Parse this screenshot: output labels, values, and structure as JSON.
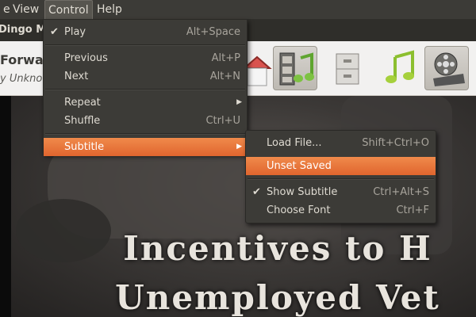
{
  "menubar": {
    "items": [
      "e",
      "View",
      "Control",
      "Help"
    ]
  },
  "window_title": "Dingo Me",
  "now_playing": {
    "title": "Forwar",
    "artist": "y Unkno"
  },
  "toolbar": {
    "buttons": [
      {
        "icon": "home-icon"
      },
      {
        "icon": "music-video-icon"
      },
      {
        "icon": "cabinet-icon"
      },
      {
        "icon": "music-note-icon"
      },
      {
        "icon": "film-reel-icon"
      }
    ]
  },
  "video_caption": {
    "line1": "Incentives to H",
    "line2": "Unemployed Vet"
  },
  "control_menu": {
    "items": [
      {
        "label": "Play",
        "accel": "Alt+Space",
        "checked": true
      },
      {
        "label": "Previous",
        "accel": "Alt+P"
      },
      {
        "label": "Next",
        "accel": "Alt+N"
      },
      {
        "label": "Repeat",
        "accel": ""
      },
      {
        "label": "Shuffle",
        "accel": "Ctrl+U"
      },
      {
        "label": "Subtitle",
        "accel": ""
      }
    ]
  },
  "subtitle_menu": {
    "items": [
      {
        "label": "Load File...",
        "accel": "Shift+Ctrl+O"
      },
      {
        "label": "Unset Saved",
        "accel": ""
      },
      {
        "label": "Show Subtitle",
        "accel": "Ctrl+Alt+S",
        "checked": true
      },
      {
        "label": "Choose Font",
        "accel": "Ctrl+F"
      }
    ]
  },
  "colors": {
    "menu_bg": "#3c3b37",
    "highlight": "#e9763d",
    "menu_text": "#dfdbd2"
  }
}
